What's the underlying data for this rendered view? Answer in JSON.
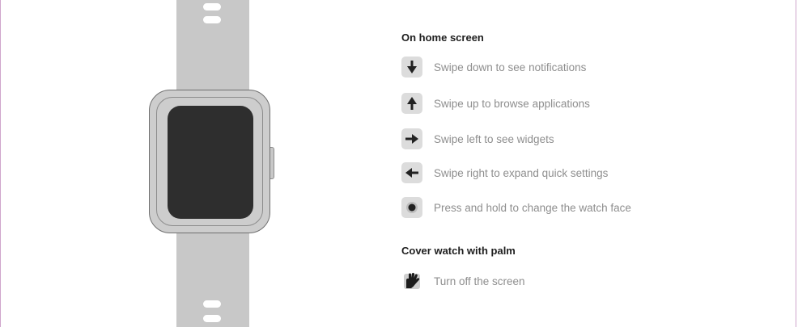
{
  "home_section": {
    "title": "On home screen",
    "items": [
      {
        "icon": "swipe-down-icon",
        "label": "Swipe down to see notifications"
      },
      {
        "icon": "swipe-up-icon",
        "label": "Swipe up to browse applications"
      },
      {
        "icon": "swipe-left-icon",
        "label": "Swipe left to see widgets"
      },
      {
        "icon": "swipe-right-icon",
        "label": "Swipe right to expand quick settings"
      },
      {
        "icon": "press-hold-icon",
        "label": "Press and hold to change the watch face"
      }
    ]
  },
  "palm_section": {
    "title": "Cover watch with palm",
    "items": [
      {
        "icon": "palm-icon",
        "label": "Turn off the screen"
      }
    ]
  },
  "colors": {
    "frame_border": "#cfa6cc",
    "watch_body": "#c8c8c8",
    "watch_screen": "#2e2e2e",
    "icon_background": "#dcdcdc",
    "icon_glyph": "#222222",
    "title_text": "#1e1e1e",
    "item_text": "#8e8e8e"
  }
}
